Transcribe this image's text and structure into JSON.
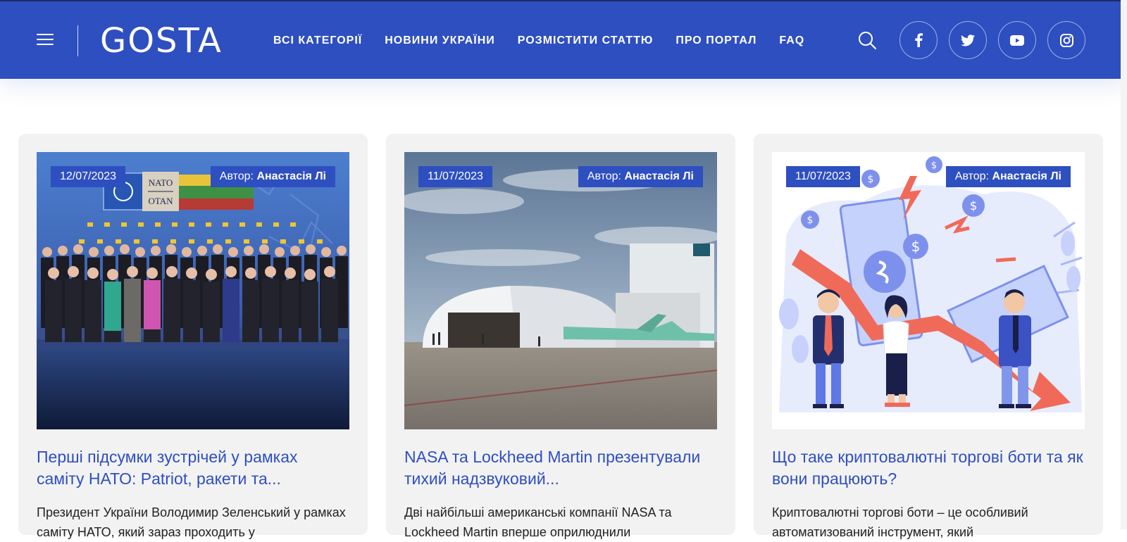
{
  "header": {
    "logo": "GOSTA",
    "nav": [
      "ВСІ КАТЕГОРІЇ",
      "НОВИНИ УКРАЇНИ",
      "РОЗМІСТИТИ СТАТТЮ",
      "ПРО ПОРТАЛ",
      "FAQ"
    ],
    "icons": [
      "menu-icon",
      "search-icon",
      "facebook-icon",
      "twitter-icon",
      "youtube-icon",
      "instagram-icon"
    ],
    "colors": {
      "brand": "#2e4fc0",
      "text_dark": "#222222",
      "card_bg": "#f2f2f2"
    }
  },
  "articles": [
    {
      "date": "12/07/2023",
      "author_label": "Автор:",
      "author": "Анастасія Лі",
      "title": "Перші підсумки зустрічей у рамках саміту НАТО: Patriot, ракети та...",
      "excerpt": "Президент України Володимир Зеленський у рамках саміту НАТО, який зараз проходить у"
    },
    {
      "date": "11/07/2023",
      "author_label": "Автор:",
      "author": "Анастасія Лі",
      "title": "NASA та Lockheed Martin презентували тихий надзвуковий...",
      "excerpt": "Дві найбільші американські компанії NASA та Lockheed Martin вперше оприлюднили"
    },
    {
      "date": "11/07/2023",
      "author_label": "Автор:",
      "author": "Анастасія Лі",
      "title": "Що таке криптовалютні торгові боти та як вони працюють?",
      "excerpt": "Криптовалютні торгові боти – це особливий автоматизований інструмент, який"
    }
  ],
  "image_texts": {
    "nato_sign": "NATO",
    "otan_sign": "OTAN"
  }
}
